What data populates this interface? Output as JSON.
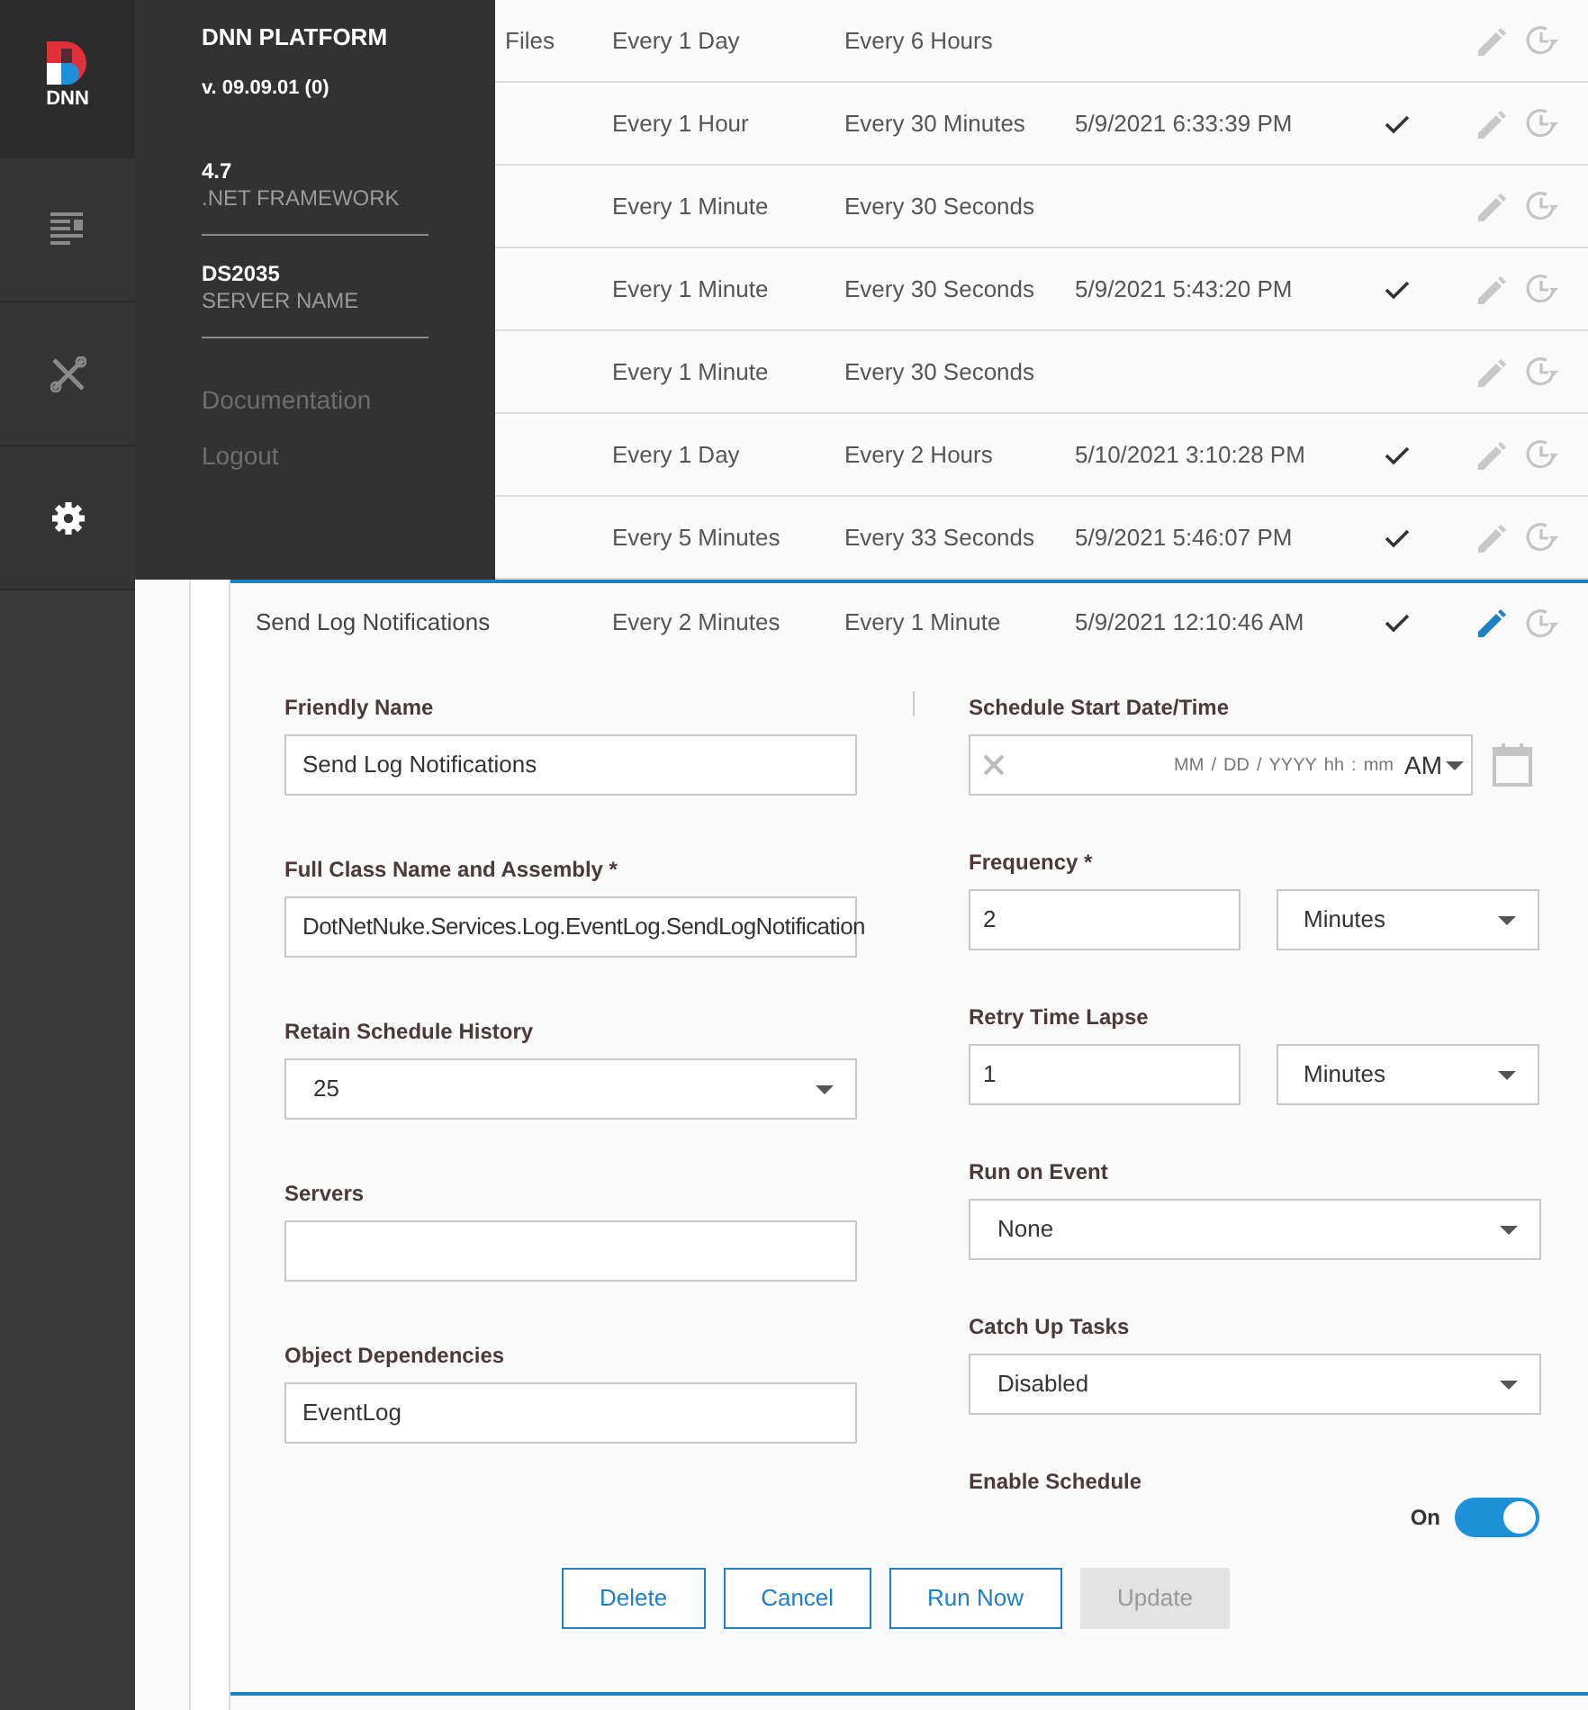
{
  "sidebar": {
    "logo": "DNN",
    "items": [
      {
        "kind": "pages",
        "selected": false
      },
      {
        "kind": "tools",
        "selected": false
      },
      {
        "kind": "settings",
        "selected": true
      }
    ]
  },
  "info_panel": {
    "title": "DNN PLATFORM",
    "version": "v. 09.09.01 (0)",
    "facts": [
      {
        "value": "4.7",
        "label": ".NET FRAMEWORK"
      },
      {
        "value": "DS2035",
        "label": "SERVER NAME"
      }
    ],
    "links": [
      "Documentation",
      "Logout"
    ]
  },
  "table": {
    "rows": [
      {
        "name": "Files",
        "frequency": "Every 1 Day",
        "retry": "Every 6 Hours",
        "enabled": false,
        "editing": false
      },
      {
        "frequency": "Every 1 Hour",
        "retry": "Every 30 Minutes",
        "next_start": "5/9/2021 6:33:39 PM",
        "enabled": true,
        "editing": false
      },
      {
        "frequency": "Every 1 Minute",
        "retry": "Every 30 Seconds",
        "enabled": false,
        "editing": false
      },
      {
        "frequency": "Every 1 Minute",
        "retry": "Every 30 Seconds",
        "next_start": "5/9/2021 5:43:20 PM",
        "enabled": true,
        "editing": false
      },
      {
        "frequency": "Every 1 Minute",
        "retry": "Every 30 Seconds",
        "enabled": false,
        "editing": false
      },
      {
        "frequency": "Every 1 Day",
        "retry": "Every 2 Hours",
        "next_start": "5/10/2021 3:10:28 PM",
        "enabled": true,
        "editing": false
      },
      {
        "frequency": "Every 5 Minutes",
        "retry": "Every 33 Seconds",
        "next_start": "5/9/2021 5:46:07 PM",
        "enabled": true,
        "editing": false
      },
      {
        "name": "Send Log Notifications",
        "frequency": "Every 2 Minutes",
        "retry": "Every 1 Minute",
        "next_start": "5/9/2021 12:10:46 AM",
        "enabled": true,
        "editing": true
      }
    ]
  },
  "form": {
    "left": [
      {
        "kind": "text",
        "label": "Friendly Name",
        "value": "Send Log Notifications"
      },
      {
        "kind": "text",
        "label": "Full Class Name and Assembly *",
        "value": "DotNetNuke.Services.Log.EventLog.SendLogNotification"
      },
      {
        "kind": "select",
        "label": "Retain Schedule History",
        "value": "25"
      },
      {
        "kind": "text",
        "label": "Servers"
      },
      {
        "kind": "text",
        "label": "Object Dependencies",
        "value": "EventLog"
      }
    ],
    "right": [
      {
        "kind": "datetime",
        "label": "Schedule Start Date/Time",
        "segments": [
          "MM",
          "/",
          "DD",
          "/",
          "YYYY",
          "hh",
          ":",
          "mm"
        ],
        "meridiem": "AM"
      },
      {
        "kind": "interval",
        "label": "Frequency *",
        "value": "2",
        "unit": "Minutes"
      },
      {
        "kind": "interval",
        "label": "Retry Time Lapse",
        "value": "1",
        "unit": "Minutes"
      },
      {
        "kind": "select",
        "label": "Run on Event",
        "value": "None"
      },
      {
        "kind": "select",
        "label": "Catch Up Tasks",
        "value": "Disabled"
      },
      {
        "kind": "toggle",
        "label": "Enable Schedule",
        "state_label": "On",
        "on": true
      }
    ],
    "buttons": [
      {
        "label": "Delete",
        "disabled": false
      },
      {
        "label": "Cancel",
        "disabled": false
      },
      {
        "label": "Run Now",
        "disabled": false
      },
      {
        "label": "Update",
        "disabled": true
      }
    ]
  }
}
